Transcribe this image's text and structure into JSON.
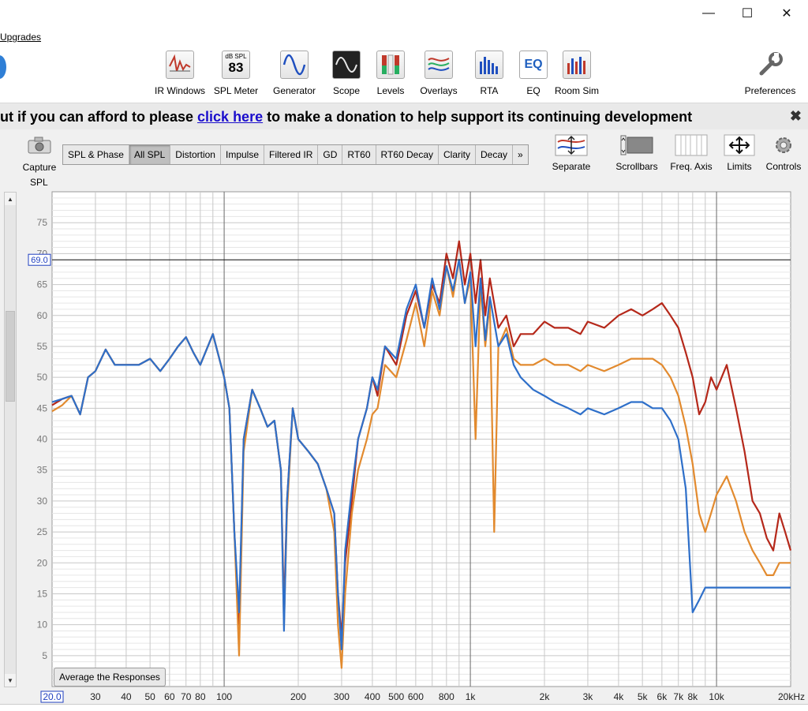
{
  "window": {
    "minimize": "—",
    "maximize": "☐",
    "close": "✕"
  },
  "menu": {
    "upgrades": "Upgrades"
  },
  "toolbar": {
    "items": [
      {
        "label": "IR Windows",
        "icon": "ir-windows-icon"
      },
      {
        "label": "SPL Meter",
        "icon": "spl-meter-icon",
        "meter_caption": "dB SPL",
        "meter_value": "83"
      },
      {
        "label": "Generator",
        "icon": "generator-icon"
      },
      {
        "label": "Scope",
        "icon": "scope-icon"
      },
      {
        "label": "Levels",
        "icon": "levels-icon"
      },
      {
        "label": "Overlays",
        "icon": "overlays-icon"
      },
      {
        "label": "RTA",
        "icon": "rta-icon"
      },
      {
        "label": "EQ",
        "icon": "eq-icon"
      },
      {
        "label": "Room Sim",
        "icon": "room-sim-icon"
      }
    ],
    "preferences": "Preferences"
  },
  "banner": {
    "before": "ut if you can afford to please ",
    "link": "click here",
    "after": " to make a donation to help support its continuing development",
    "close": "✖"
  },
  "capture": {
    "label": "Capture"
  },
  "tabs": [
    "SPL & Phase",
    "All SPL",
    "Distortion",
    "Impulse",
    "Filtered IR",
    "GD",
    "RT60",
    "RT60 Decay",
    "Clarity",
    "Decay",
    "»"
  ],
  "active_tab": "All SPL",
  "right_tools": {
    "separate": "Separate",
    "scrollbars": "Scrollbars",
    "freq_axis": "Freq. Axis",
    "limits": "Limits",
    "controls": "Controls"
  },
  "average_button": "Average the Responses",
  "chart_data": {
    "type": "line",
    "ylabel": "SPL",
    "x_scale": "log",
    "xlim": [
      20,
      20000
    ],
    "ylim": [
      0,
      80
    ],
    "y_ticks": [
      5,
      10,
      15,
      20,
      25,
      30,
      35,
      40,
      45,
      50,
      55,
      60,
      65,
      70,
      75
    ],
    "x_tick_labels": [
      {
        "x": 30,
        "label": "30"
      },
      {
        "x": 40,
        "label": "40"
      },
      {
        "x": 50,
        "label": "50"
      },
      {
        "x": 60,
        "label": "60"
      },
      {
        "x": 70,
        "label": "70"
      },
      {
        "x": 80,
        "label": "80"
      },
      {
        "x": 100,
        "label": "100"
      },
      {
        "x": 200,
        "label": "200"
      },
      {
        "x": 300,
        "label": "300"
      },
      {
        "x": 400,
        "label": "400"
      },
      {
        "x": 500,
        "label": "500"
      },
      {
        "x": 600,
        "label": "600"
      },
      {
        "x": 800,
        "label": "800"
      },
      {
        "x": 1000,
        "label": "1k"
      },
      {
        "x": 2000,
        "label": "2k"
      },
      {
        "x": 3000,
        "label": "3k"
      },
      {
        "x": 4000,
        "label": "4k"
      },
      {
        "x": 5000,
        "label": "5k"
      },
      {
        "x": 6000,
        "label": "6k"
      },
      {
        "x": 7000,
        "label": "7k"
      },
      {
        "x": 8000,
        "label": "8k"
      },
      {
        "x": 10000,
        "label": "10k"
      },
      {
        "x": 20000,
        "label": "20kHz"
      }
    ],
    "x_start_label": "20.0",
    "cursor": {
      "y": 69.0,
      "label": "69.0"
    },
    "grid": true,
    "series": [
      {
        "color": "#b5281a",
        "points": [
          [
            20,
            45.5
          ],
          [
            22,
            46.5
          ],
          [
            24,
            47
          ],
          [
            26,
            44
          ],
          [
            28,
            50
          ],
          [
            30,
            51
          ],
          [
            33,
            54.5
          ],
          [
            36,
            52
          ],
          [
            40,
            52
          ],
          [
            45,
            52
          ],
          [
            50,
            53
          ],
          [
            55,
            51
          ],
          [
            60,
            53
          ],
          [
            65,
            55
          ],
          [
            70,
            56.5
          ],
          [
            75,
            54
          ],
          [
            80,
            52
          ],
          [
            90,
            57
          ],
          [
            100,
            50
          ],
          [
            105,
            45
          ],
          [
            110,
            25
          ],
          [
            115,
            10
          ],
          [
            120,
            40
          ],
          [
            130,
            48
          ],
          [
            140,
            45
          ],
          [
            150,
            42
          ],
          [
            160,
            43
          ],
          [
            170,
            35
          ],
          [
            175,
            12
          ],
          [
            180,
            30
          ],
          [
            190,
            45
          ],
          [
            200,
            40
          ],
          [
            220,
            38
          ],
          [
            240,
            36
          ],
          [
            260,
            32
          ],
          [
            280,
            28
          ],
          [
            290,
            15
          ],
          [
            300,
            8
          ],
          [
            310,
            20
          ],
          [
            330,
            30
          ],
          [
            350,
            40
          ],
          [
            380,
            45
          ],
          [
            400,
            50
          ],
          [
            420,
            47
          ],
          [
            450,
            55
          ],
          [
            500,
            52
          ],
          [
            550,
            60
          ],
          [
            600,
            64
          ],
          [
            650,
            58
          ],
          [
            700,
            65
          ],
          [
            750,
            62
          ],
          [
            800,
            70
          ],
          [
            850,
            66
          ],
          [
            900,
            72
          ],
          [
            950,
            65
          ],
          [
            1000,
            70
          ],
          [
            1050,
            62
          ],
          [
            1100,
            69
          ],
          [
            1150,
            60
          ],
          [
            1200,
            66
          ],
          [
            1300,
            58
          ],
          [
            1400,
            60
          ],
          [
            1500,
            55
          ],
          [
            1600,
            57
          ],
          [
            1800,
            57
          ],
          [
            2000,
            59
          ],
          [
            2200,
            58
          ],
          [
            2500,
            58
          ],
          [
            2800,
            57
          ],
          [
            3000,
            59
          ],
          [
            3500,
            58
          ],
          [
            4000,
            60
          ],
          [
            4500,
            61
          ],
          [
            5000,
            60
          ],
          [
            5500,
            61
          ],
          [
            6000,
            62
          ],
          [
            6500,
            60
          ],
          [
            7000,
            58
          ],
          [
            7500,
            54
          ],
          [
            8000,
            50
          ],
          [
            8500,
            44
          ],
          [
            9000,
            46
          ],
          [
            9500,
            50
          ],
          [
            10000,
            48
          ],
          [
            11000,
            52
          ],
          [
            12000,
            45
          ],
          [
            13000,
            38
          ],
          [
            14000,
            30
          ],
          [
            15000,
            28
          ],
          [
            16000,
            24
          ],
          [
            17000,
            22
          ],
          [
            18000,
            28
          ],
          [
            19000,
            25
          ],
          [
            20000,
            22
          ]
        ]
      },
      {
        "color": "#e28a2e",
        "points": [
          [
            20,
            44.5
          ],
          [
            22,
            45.5
          ],
          [
            24,
            47
          ],
          [
            26,
            44
          ],
          [
            28,
            50
          ],
          [
            30,
            51
          ],
          [
            33,
            54.5
          ],
          [
            36,
            52
          ],
          [
            40,
            52
          ],
          [
            45,
            52
          ],
          [
            50,
            53
          ],
          [
            55,
            51
          ],
          [
            60,
            53
          ],
          [
            65,
            55
          ],
          [
            70,
            56.5
          ],
          [
            75,
            54
          ],
          [
            80,
            52
          ],
          [
            90,
            57
          ],
          [
            100,
            50
          ],
          [
            105,
            45
          ],
          [
            110,
            25
          ],
          [
            115,
            5
          ],
          [
            120,
            38
          ],
          [
            130,
            48
          ],
          [
            140,
            45
          ],
          [
            150,
            42
          ],
          [
            160,
            43
          ],
          [
            170,
            35
          ],
          [
            175,
            10
          ],
          [
            180,
            28
          ],
          [
            190,
            45
          ],
          [
            200,
            40
          ],
          [
            220,
            38
          ],
          [
            240,
            36
          ],
          [
            260,
            32
          ],
          [
            280,
            25
          ],
          [
            290,
            10
          ],
          [
            300,
            3
          ],
          [
            310,
            15
          ],
          [
            330,
            28
          ],
          [
            350,
            35
          ],
          [
            380,
            40
          ],
          [
            400,
            44
          ],
          [
            420,
            45
          ],
          [
            450,
            52
          ],
          [
            500,
            50
          ],
          [
            550,
            56
          ],
          [
            600,
            62
          ],
          [
            650,
            55
          ],
          [
            700,
            64
          ],
          [
            750,
            60
          ],
          [
            800,
            68
          ],
          [
            850,
            63
          ],
          [
            900,
            69
          ],
          [
            950,
            62
          ],
          [
            1000,
            66
          ],
          [
            1050,
            40
          ],
          [
            1100,
            65
          ],
          [
            1150,
            55
          ],
          [
            1200,
            62
          ],
          [
            1250,
            25
          ],
          [
            1300,
            55
          ],
          [
            1400,
            58
          ],
          [
            1500,
            53
          ],
          [
            1600,
            52
          ],
          [
            1800,
            52
          ],
          [
            2000,
            53
          ],
          [
            2200,
            52
          ],
          [
            2500,
            52
          ],
          [
            2800,
            51
          ],
          [
            3000,
            52
          ],
          [
            3500,
            51
          ],
          [
            4000,
            52
          ],
          [
            4500,
            53
          ],
          [
            5000,
            53
          ],
          [
            5500,
            53
          ],
          [
            6000,
            52
          ],
          [
            6500,
            50
          ],
          [
            7000,
            47
          ],
          [
            7500,
            42
          ],
          [
            8000,
            36
          ],
          [
            8500,
            28
          ],
          [
            9000,
            25
          ],
          [
            9500,
            28
          ],
          [
            10000,
            31
          ],
          [
            11000,
            34
          ],
          [
            12000,
            30
          ],
          [
            13000,
            25
          ],
          [
            14000,
            22
          ],
          [
            15000,
            20
          ],
          [
            16000,
            18
          ],
          [
            17000,
            18
          ],
          [
            18000,
            20
          ],
          [
            19000,
            20
          ],
          [
            20000,
            20
          ]
        ]
      },
      {
        "color": "#2e6fc9",
        "points": [
          [
            20,
            46
          ],
          [
            22,
            46.5
          ],
          [
            24,
            47
          ],
          [
            26,
            44
          ],
          [
            28,
            50
          ],
          [
            30,
            51
          ],
          [
            33,
            54.5
          ],
          [
            36,
            52
          ],
          [
            40,
            52
          ],
          [
            45,
            52
          ],
          [
            50,
            53
          ],
          [
            55,
            51
          ],
          [
            60,
            53
          ],
          [
            65,
            55
          ],
          [
            70,
            56.5
          ],
          [
            75,
            54
          ],
          [
            80,
            52
          ],
          [
            90,
            57
          ],
          [
            100,
            50
          ],
          [
            105,
            45
          ],
          [
            110,
            25
          ],
          [
            115,
            12
          ],
          [
            120,
            40
          ],
          [
            130,
            48
          ],
          [
            140,
            45
          ],
          [
            150,
            42
          ],
          [
            160,
            43
          ],
          [
            170,
            35
          ],
          [
            175,
            9
          ],
          [
            180,
            30
          ],
          [
            190,
            45
          ],
          [
            200,
            40
          ],
          [
            220,
            38
          ],
          [
            240,
            36
          ],
          [
            260,
            32
          ],
          [
            280,
            28
          ],
          [
            290,
            15
          ],
          [
            300,
            6
          ],
          [
            310,
            22
          ],
          [
            330,
            32
          ],
          [
            350,
            40
          ],
          [
            380,
            45
          ],
          [
            400,
            50
          ],
          [
            420,
            48
          ],
          [
            450,
            55
          ],
          [
            500,
            53
          ],
          [
            550,
            61
          ],
          [
            600,
            65
          ],
          [
            650,
            58
          ],
          [
            700,
            66
          ],
          [
            750,
            61
          ],
          [
            800,
            68
          ],
          [
            850,
            64
          ],
          [
            900,
            69
          ],
          [
            950,
            62
          ],
          [
            1000,
            67
          ],
          [
            1050,
            55
          ],
          [
            1100,
            66
          ],
          [
            1150,
            56
          ],
          [
            1200,
            63
          ],
          [
            1300,
            55
          ],
          [
            1400,
            57
          ],
          [
            1500,
            52
          ],
          [
            1600,
            50
          ],
          [
            1800,
            48
          ],
          [
            2000,
            47
          ],
          [
            2200,
            46
          ],
          [
            2500,
            45
          ],
          [
            2800,
            44
          ],
          [
            3000,
            45
          ],
          [
            3500,
            44
          ],
          [
            4000,
            45
          ],
          [
            4500,
            46
          ],
          [
            5000,
            46
          ],
          [
            5500,
            45
          ],
          [
            6000,
            45
          ],
          [
            6500,
            43
          ],
          [
            7000,
            40
          ],
          [
            7500,
            32
          ],
          [
            8000,
            12
          ],
          [
            8500,
            14
          ],
          [
            9000,
            16
          ],
          [
            9500,
            16
          ],
          [
            10000,
            16
          ],
          [
            11000,
            16
          ],
          [
            12000,
            16
          ],
          [
            13000,
            16
          ],
          [
            14000,
            16
          ],
          [
            15000,
            16
          ],
          [
            16000,
            16
          ],
          [
            17000,
            16
          ],
          [
            18000,
            16
          ],
          [
            19000,
            16
          ],
          [
            20000,
            16
          ]
        ]
      }
    ]
  }
}
